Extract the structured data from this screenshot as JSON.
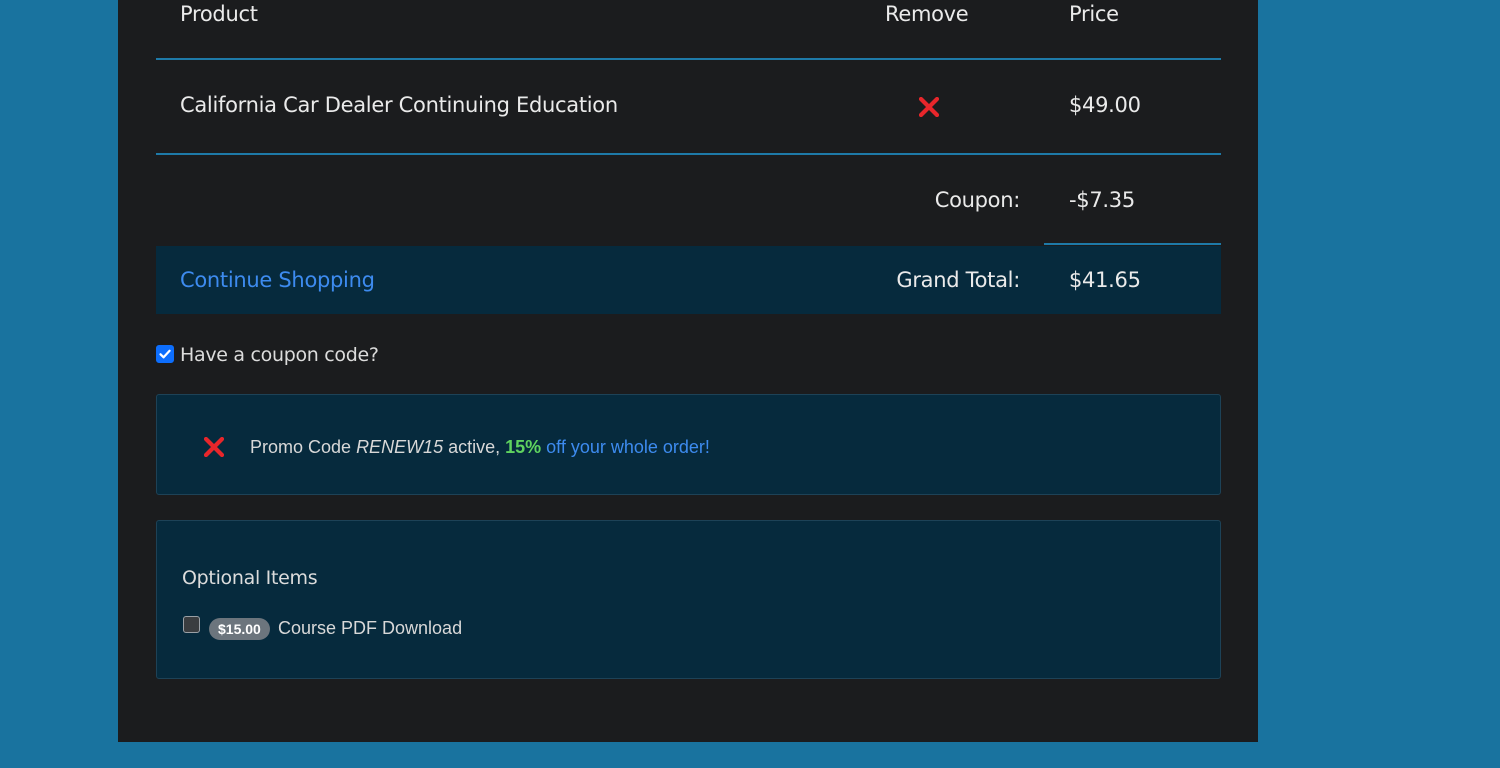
{
  "cart": {
    "headers": {
      "product": "Product",
      "remove": "Remove",
      "price": "Price"
    },
    "items": [
      {
        "name": "California Car Dealer Continuing Education",
        "remove_icon": "close-icon",
        "price": "$49.00"
      }
    ],
    "coupon_label": "Coupon:",
    "coupon_value": "-$7.35",
    "continue_shopping": "Continue Shopping",
    "grand_total_label": "Grand Total:",
    "grand_total_value": "$41.65"
  },
  "coupon": {
    "checkbox_label": "Have a coupon code?",
    "checked": true,
    "promo": {
      "prefix": "Promo Code ",
      "code": "RENEW15",
      "middle": " active, ",
      "percent": "15%",
      "suffix": " off your whole order!"
    }
  },
  "optional": {
    "title": "Optional Items",
    "items": [
      {
        "price": "$15.00",
        "label": "Course PDF Download",
        "checked": false
      }
    ]
  },
  "colors": {
    "page_background": "#19739f",
    "panel_background": "#1b1c1e",
    "accent_line": "#1e7aa8",
    "link": "#3d8bef",
    "remove_icon": "#e8262b",
    "highlight_green": "#5fd35f"
  }
}
